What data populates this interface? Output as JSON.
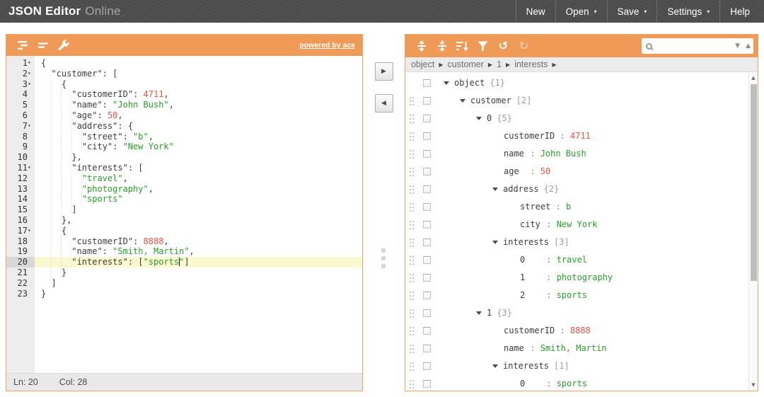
{
  "colors": {
    "accent_orange": "#ef9b57",
    "panel_border": "#eba367",
    "header_bg": "#4a4a4a",
    "string_green": "#28a028",
    "number_red": "#ee5244",
    "active_line_bg": "#fbf7ce",
    "bar_gray": "#ebebeb"
  },
  "header": {
    "brand_primary": "JSON Editor",
    "brand_secondary": "Online",
    "caret_glyph": "▾",
    "menu": [
      {
        "label": "New",
        "dropdown": false
      },
      {
        "label": "Open",
        "dropdown": true
      },
      {
        "label": "Save",
        "dropdown": true
      },
      {
        "label": "Settings",
        "dropdown": true
      },
      {
        "label": "Help",
        "dropdown": false
      }
    ]
  },
  "editor": {
    "toolbar": {
      "icons": [
        {
          "name": "format-icon"
        },
        {
          "name": "compact-icon"
        },
        {
          "name": "repair-icon"
        }
      ],
      "powered_by": "powered by ace"
    },
    "fold_glyph": "▾",
    "active_line": 20,
    "status": {
      "line": "Ln: 20",
      "column": "Col: 28"
    },
    "lines": [
      {
        "n": 1,
        "fold": true,
        "indent": 0,
        "tokens": [
          [
            "p",
            "{"
          ]
        ]
      },
      {
        "n": 2,
        "fold": true,
        "indent": 2,
        "tokens": [
          [
            "k",
            "\"customer\""
          ],
          [
            "p",
            ": ["
          ]
        ]
      },
      {
        "n": 3,
        "fold": true,
        "indent": 4,
        "tokens": [
          [
            "p",
            "{"
          ]
        ]
      },
      {
        "n": 4,
        "indent": 6,
        "tokens": [
          [
            "k",
            "\"customerID\""
          ],
          [
            "p",
            ": "
          ],
          [
            "num",
            "4711"
          ],
          [
            "p",
            ","
          ]
        ]
      },
      {
        "n": 5,
        "indent": 6,
        "tokens": [
          [
            "k",
            "\"name\""
          ],
          [
            "p",
            ": "
          ],
          [
            "str",
            "\"John Bush\""
          ],
          [
            "p",
            ","
          ]
        ]
      },
      {
        "n": 6,
        "indent": 6,
        "tokens": [
          [
            "k",
            "\"age\""
          ],
          [
            "p",
            ": "
          ],
          [
            "num",
            "50"
          ],
          [
            "p",
            ","
          ]
        ]
      },
      {
        "n": 7,
        "fold": true,
        "indent": 6,
        "tokens": [
          [
            "k",
            "\"address\""
          ],
          [
            "p",
            ": {"
          ]
        ]
      },
      {
        "n": 8,
        "indent": 8,
        "tokens": [
          [
            "k",
            "\"street\""
          ],
          [
            "p",
            ": "
          ],
          [
            "str",
            "\"b\""
          ],
          [
            "p",
            ","
          ]
        ]
      },
      {
        "n": 9,
        "indent": 8,
        "tokens": [
          [
            "k",
            "\"city\""
          ],
          [
            "p",
            ": "
          ],
          [
            "str",
            "\"New York\""
          ]
        ]
      },
      {
        "n": 10,
        "indent": 6,
        "tokens": [
          [
            "p",
            "},"
          ]
        ]
      },
      {
        "n": 11,
        "fold": true,
        "indent": 6,
        "tokens": [
          [
            "k",
            "\"interests\""
          ],
          [
            "p",
            ": ["
          ]
        ]
      },
      {
        "n": 12,
        "indent": 8,
        "tokens": [
          [
            "str",
            "\"travel\""
          ],
          [
            "p",
            ","
          ]
        ]
      },
      {
        "n": 13,
        "indent": 8,
        "tokens": [
          [
            "str",
            "\"photography\""
          ],
          [
            "p",
            ","
          ]
        ]
      },
      {
        "n": 14,
        "indent": 8,
        "tokens": [
          [
            "str",
            "\"sports\""
          ]
        ]
      },
      {
        "n": 15,
        "indent": 6,
        "tokens": [
          [
            "p",
            "]"
          ]
        ]
      },
      {
        "n": 16,
        "indent": 4,
        "tokens": [
          [
            "p",
            "},"
          ]
        ]
      },
      {
        "n": 17,
        "fold": true,
        "indent": 4,
        "tokens": [
          [
            "p",
            "{"
          ]
        ]
      },
      {
        "n": 18,
        "indent": 6,
        "tokens": [
          [
            "k",
            "\"customerID\""
          ],
          [
            "p",
            ": "
          ],
          [
            "num",
            "8888"
          ],
          [
            "p",
            ","
          ]
        ]
      },
      {
        "n": 19,
        "indent": 6,
        "tokens": [
          [
            "k",
            "\"name\""
          ],
          [
            "p",
            ": "
          ],
          [
            "str",
            "\"Smith, Martin\""
          ],
          [
            "p",
            ","
          ]
        ]
      },
      {
        "n": 20,
        "indent": 6,
        "tokens": [
          [
            "k",
            "\"interests\""
          ],
          [
            "p",
            ": ["
          ],
          [
            "str",
            "\"sports"
          ],
          [
            "cursor",
            ""
          ],
          [
            "str",
            "\""
          ],
          [
            "p",
            "]"
          ]
        ]
      },
      {
        "n": 21,
        "indent": 4,
        "tokens": [
          [
            "p",
            "}"
          ]
        ]
      },
      {
        "n": 22,
        "indent": 2,
        "tokens": [
          [
            "p",
            "]"
          ]
        ]
      },
      {
        "n": 23,
        "indent": 0,
        "tokens": [
          [
            "p",
            "}"
          ]
        ]
      }
    ]
  },
  "transfer": {
    "right_glyph": "▶",
    "left_glyph": "◀"
  },
  "tree": {
    "toolbar": {
      "icons": [
        {
          "name": "expand-all-icon"
        },
        {
          "name": "collapse-all-icon"
        },
        {
          "name": "sort-icon"
        },
        {
          "name": "filter-icon"
        },
        {
          "name": "undo-icon",
          "glyph": "↺",
          "enabled": true
        },
        {
          "name": "redo-icon",
          "glyph": "↻",
          "enabled": false
        }
      ],
      "search": {
        "value": "",
        "next_glyph": "▼",
        "prev_glyph": "▲"
      }
    },
    "breadcrumb": [
      "object",
      "customer",
      "1",
      "interests"
    ],
    "breadcrumb_separator": "▶",
    "rows": [
      {
        "level": 0,
        "expandable": true,
        "name": "object",
        "count": "{1}",
        "drag": false
      },
      {
        "level": 1,
        "expandable": true,
        "name": "customer",
        "count": "[2]"
      },
      {
        "level": 2,
        "expandable": true,
        "name": "0",
        "count": "{5}"
      },
      {
        "level": 3,
        "name": "customerID",
        "value": "4711",
        "vtype": "number"
      },
      {
        "level": 3,
        "name": "name",
        "value": "John Bush",
        "vtype": "string"
      },
      {
        "level": 3,
        "name": "age",
        "value": "50",
        "vtype": "number"
      },
      {
        "level": 3,
        "expandable": true,
        "name": "address",
        "count": "{2}"
      },
      {
        "level": 4,
        "name": "street",
        "value": "b",
        "vtype": "string"
      },
      {
        "level": 4,
        "name": "city",
        "value": "New York",
        "vtype": "string"
      },
      {
        "level": 3,
        "expandable": true,
        "name": "interests",
        "count": "[3]"
      },
      {
        "level": 4,
        "name": "0",
        "value": "travel",
        "vtype": "string"
      },
      {
        "level": 4,
        "name": "1",
        "value": "photography",
        "vtype": "string"
      },
      {
        "level": 4,
        "name": "2",
        "value": "sports",
        "vtype": "string"
      },
      {
        "level": 2,
        "expandable": true,
        "name": "1",
        "count": "{3}"
      },
      {
        "level": 3,
        "name": "customerID",
        "value": "8888",
        "vtype": "number"
      },
      {
        "level": 3,
        "name": "name",
        "value": "Smith, Martin",
        "vtype": "string"
      },
      {
        "level": 3,
        "expandable": true,
        "name": "interests",
        "count": "[1]"
      },
      {
        "level": 4,
        "name": "0",
        "value": "sports",
        "vtype": "string"
      }
    ],
    "scrollbar": {
      "up_glyph": "▲",
      "down_glyph": "▼"
    }
  }
}
